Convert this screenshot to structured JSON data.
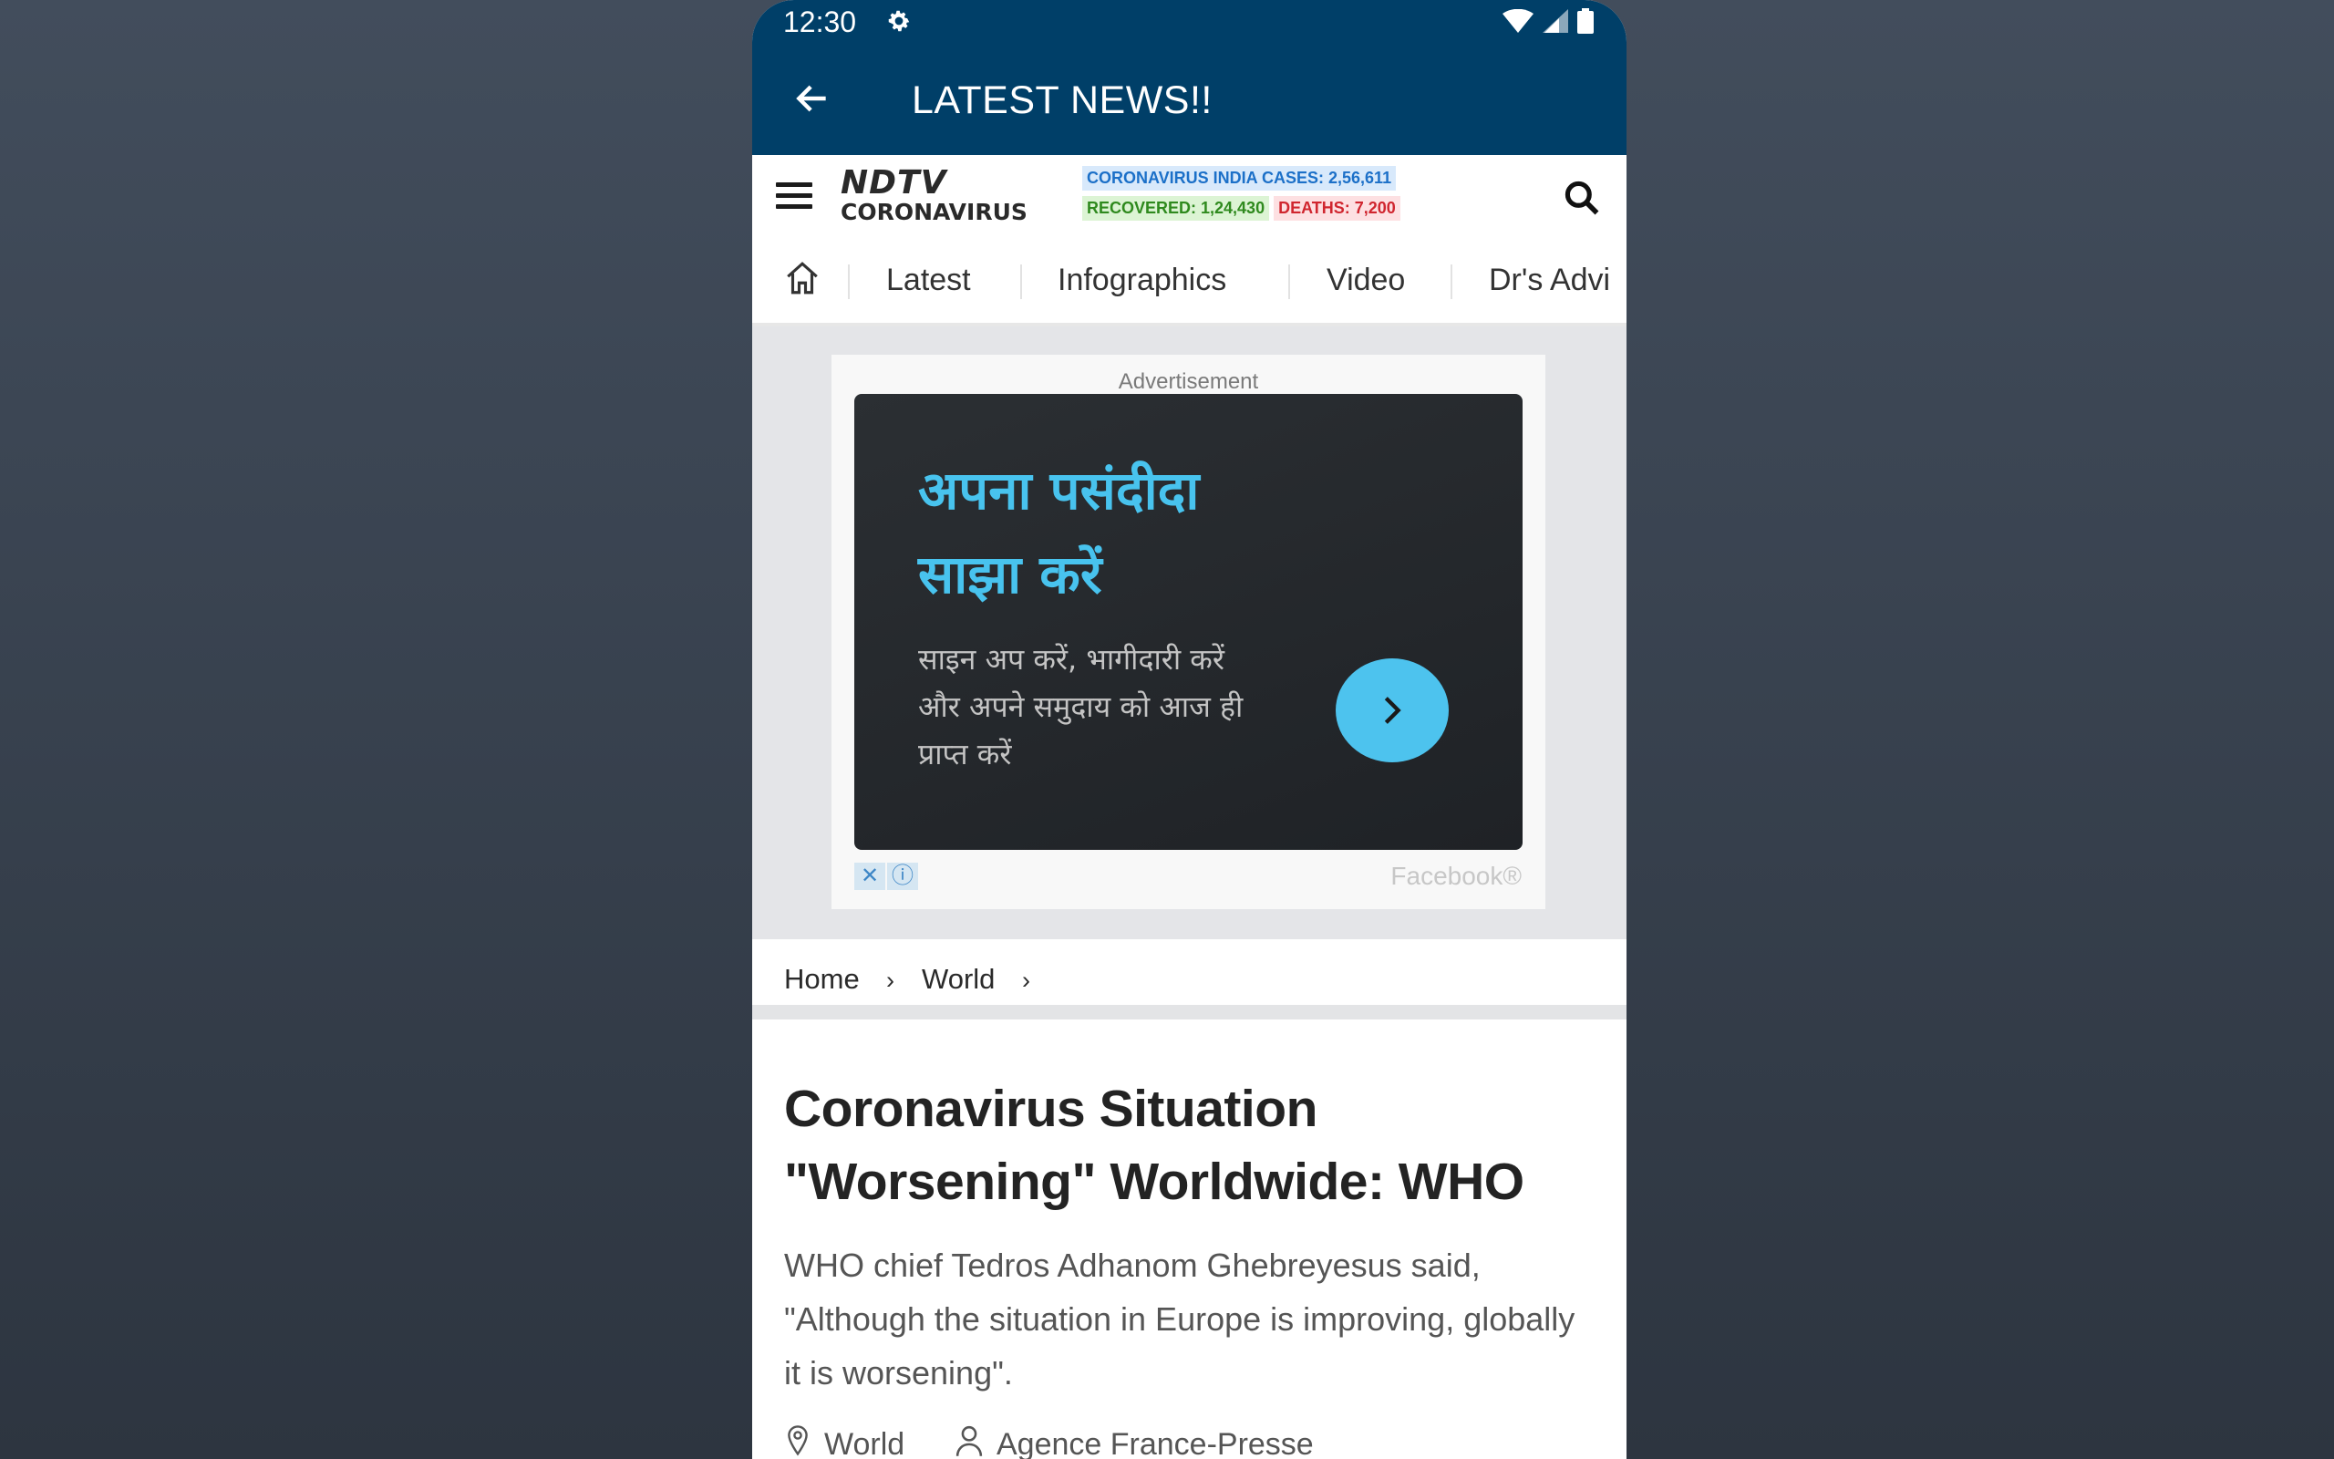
{
  "status_bar": {
    "time": "12:30",
    "icons": [
      "gear-icon",
      "wifi-icon",
      "signal-icon",
      "battery-icon"
    ]
  },
  "app_bar": {
    "title": "LATEST NEWS!!",
    "back_icon": "arrow-left-icon"
  },
  "site_header": {
    "logo_top": "NDTV",
    "logo_bottom": "CORONAVIRUS",
    "stats": {
      "cases": "CORONAVIRUS INDIA CASES: 2,56,611",
      "recovered": "RECOVERED: 1,24,430",
      "deaths": "DEATHS: 7,200"
    },
    "icons": [
      "menu-icon",
      "search-icon"
    ]
  },
  "nav": {
    "items": [
      "Latest",
      "Infographics",
      "Video",
      "Dr's Advi"
    ]
  },
  "ad": {
    "label": "Advertisement",
    "headline_line1": "अपना पसंदीदा",
    "headline_line2": "साझा करें",
    "body_line1": "साइन अप करें, भागीदारी करें",
    "body_line2": "और अपने समुदाय को आज ही",
    "body_line3": "प्राप्त करें",
    "footer": "Facebook®",
    "colors": {
      "headline": "#48c3ee",
      "cta": "#4dc3ee"
    }
  },
  "breadcrumb": {
    "home": "Home",
    "section": "World"
  },
  "article": {
    "title_line1": "Coronavirus Situation",
    "title_line2": "\"Worsening\" Worldwide: WHO",
    "summary": "WHO chief Tedros Adhanom Ghebreyesus said, \"Although the situation in Europe is improving, globally it is worsening\".",
    "category": "World",
    "author": "Agence France-Presse"
  },
  "colors": {
    "app_bar": "#003f68",
    "background": "#3a4350"
  }
}
